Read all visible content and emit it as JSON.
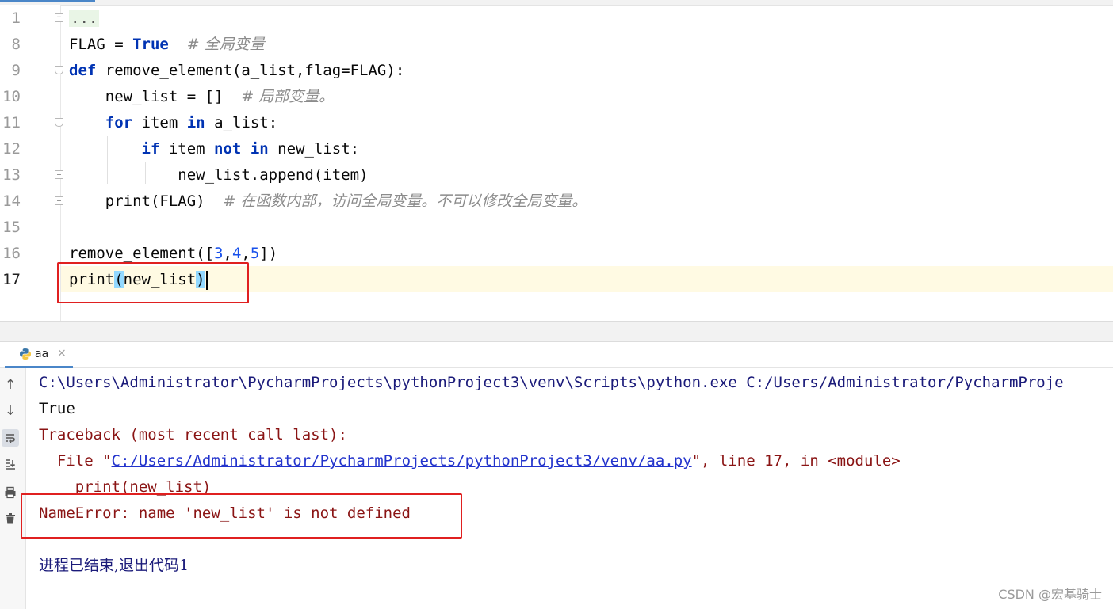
{
  "editor": {
    "line_numbers": [
      "1",
      "8",
      "9",
      "10",
      "11",
      "12",
      "13",
      "14",
      "15",
      "16",
      "17"
    ],
    "current_line": "17",
    "lines": {
      "l1": {
        "dots": "..."
      },
      "l8": {
        "pre": "FLAG = ",
        "true_kw": "True",
        "comment": "# 全局变量"
      },
      "l9": {
        "def_kw": "def",
        "rest": " remove_element(a_list,flag=FLAG):"
      },
      "l10": {
        "pre": "    new_list = []  ",
        "comment": "# 局部变量。"
      },
      "l11": {
        "indent": "    ",
        "for_kw": "for",
        "mid": " item ",
        "in_kw": "in",
        "rest": " a_list:"
      },
      "l12": {
        "indent": "        ",
        "if_kw": "if",
        "mid": " item ",
        "not_kw": "not",
        "sp": " ",
        "in_kw": "in",
        "rest": " new_list:"
      },
      "l13": {
        "text": "            new_list.append(item)"
      },
      "l14": {
        "pre": "    print(FLAG)  ",
        "comment": "# 在函数内部，访问全局变量。不可以修改全局变量。"
      },
      "l16": {
        "pre": "remove_element([",
        "n1": "3",
        "c1": ",",
        "n2": "4",
        "c2": ",",
        "n3": "5",
        "post": "])"
      },
      "l17": {
        "fn": "print",
        "open": "(",
        "arg": "new_list",
        "close": ")"
      }
    }
  },
  "run_panel": {
    "tab_label": "aa",
    "tab_close": "×",
    "tab_icon": "python-icon",
    "toolbar_icons": [
      "arrow-up-icon",
      "arrow-down-icon",
      "soft-wrap-icon",
      "scroll-to-end-icon",
      "print-icon",
      "trash-icon"
    ],
    "console": {
      "cmd": "C:\\Users\\Administrator\\PycharmProjects\\pythonProject3\\venv\\Scripts\\python.exe C:/Users/Administrator/PycharmProje",
      "out_true": "True",
      "traceback": "Traceback (most recent call last):",
      "file_pre": "  File \"",
      "file_link": "C:/Users/Administrator/PycharmProjects/pythonProject3/venv/aa.py",
      "file_post": "\", line 17, in <module>",
      "code_line": "    print(new_list)",
      "error": "NameError: name 'new_list' is not defined",
      "exit_msg": "进程已结束,退出代码1"
    }
  },
  "watermark": "CSDN @宏基骑士",
  "colors": {
    "keyword": "#0033b3",
    "number": "#1750eb",
    "comment": "#8c8c8c",
    "error": "#8a1414",
    "highlight_box": "#e02020",
    "current_line": "#fffae3"
  }
}
